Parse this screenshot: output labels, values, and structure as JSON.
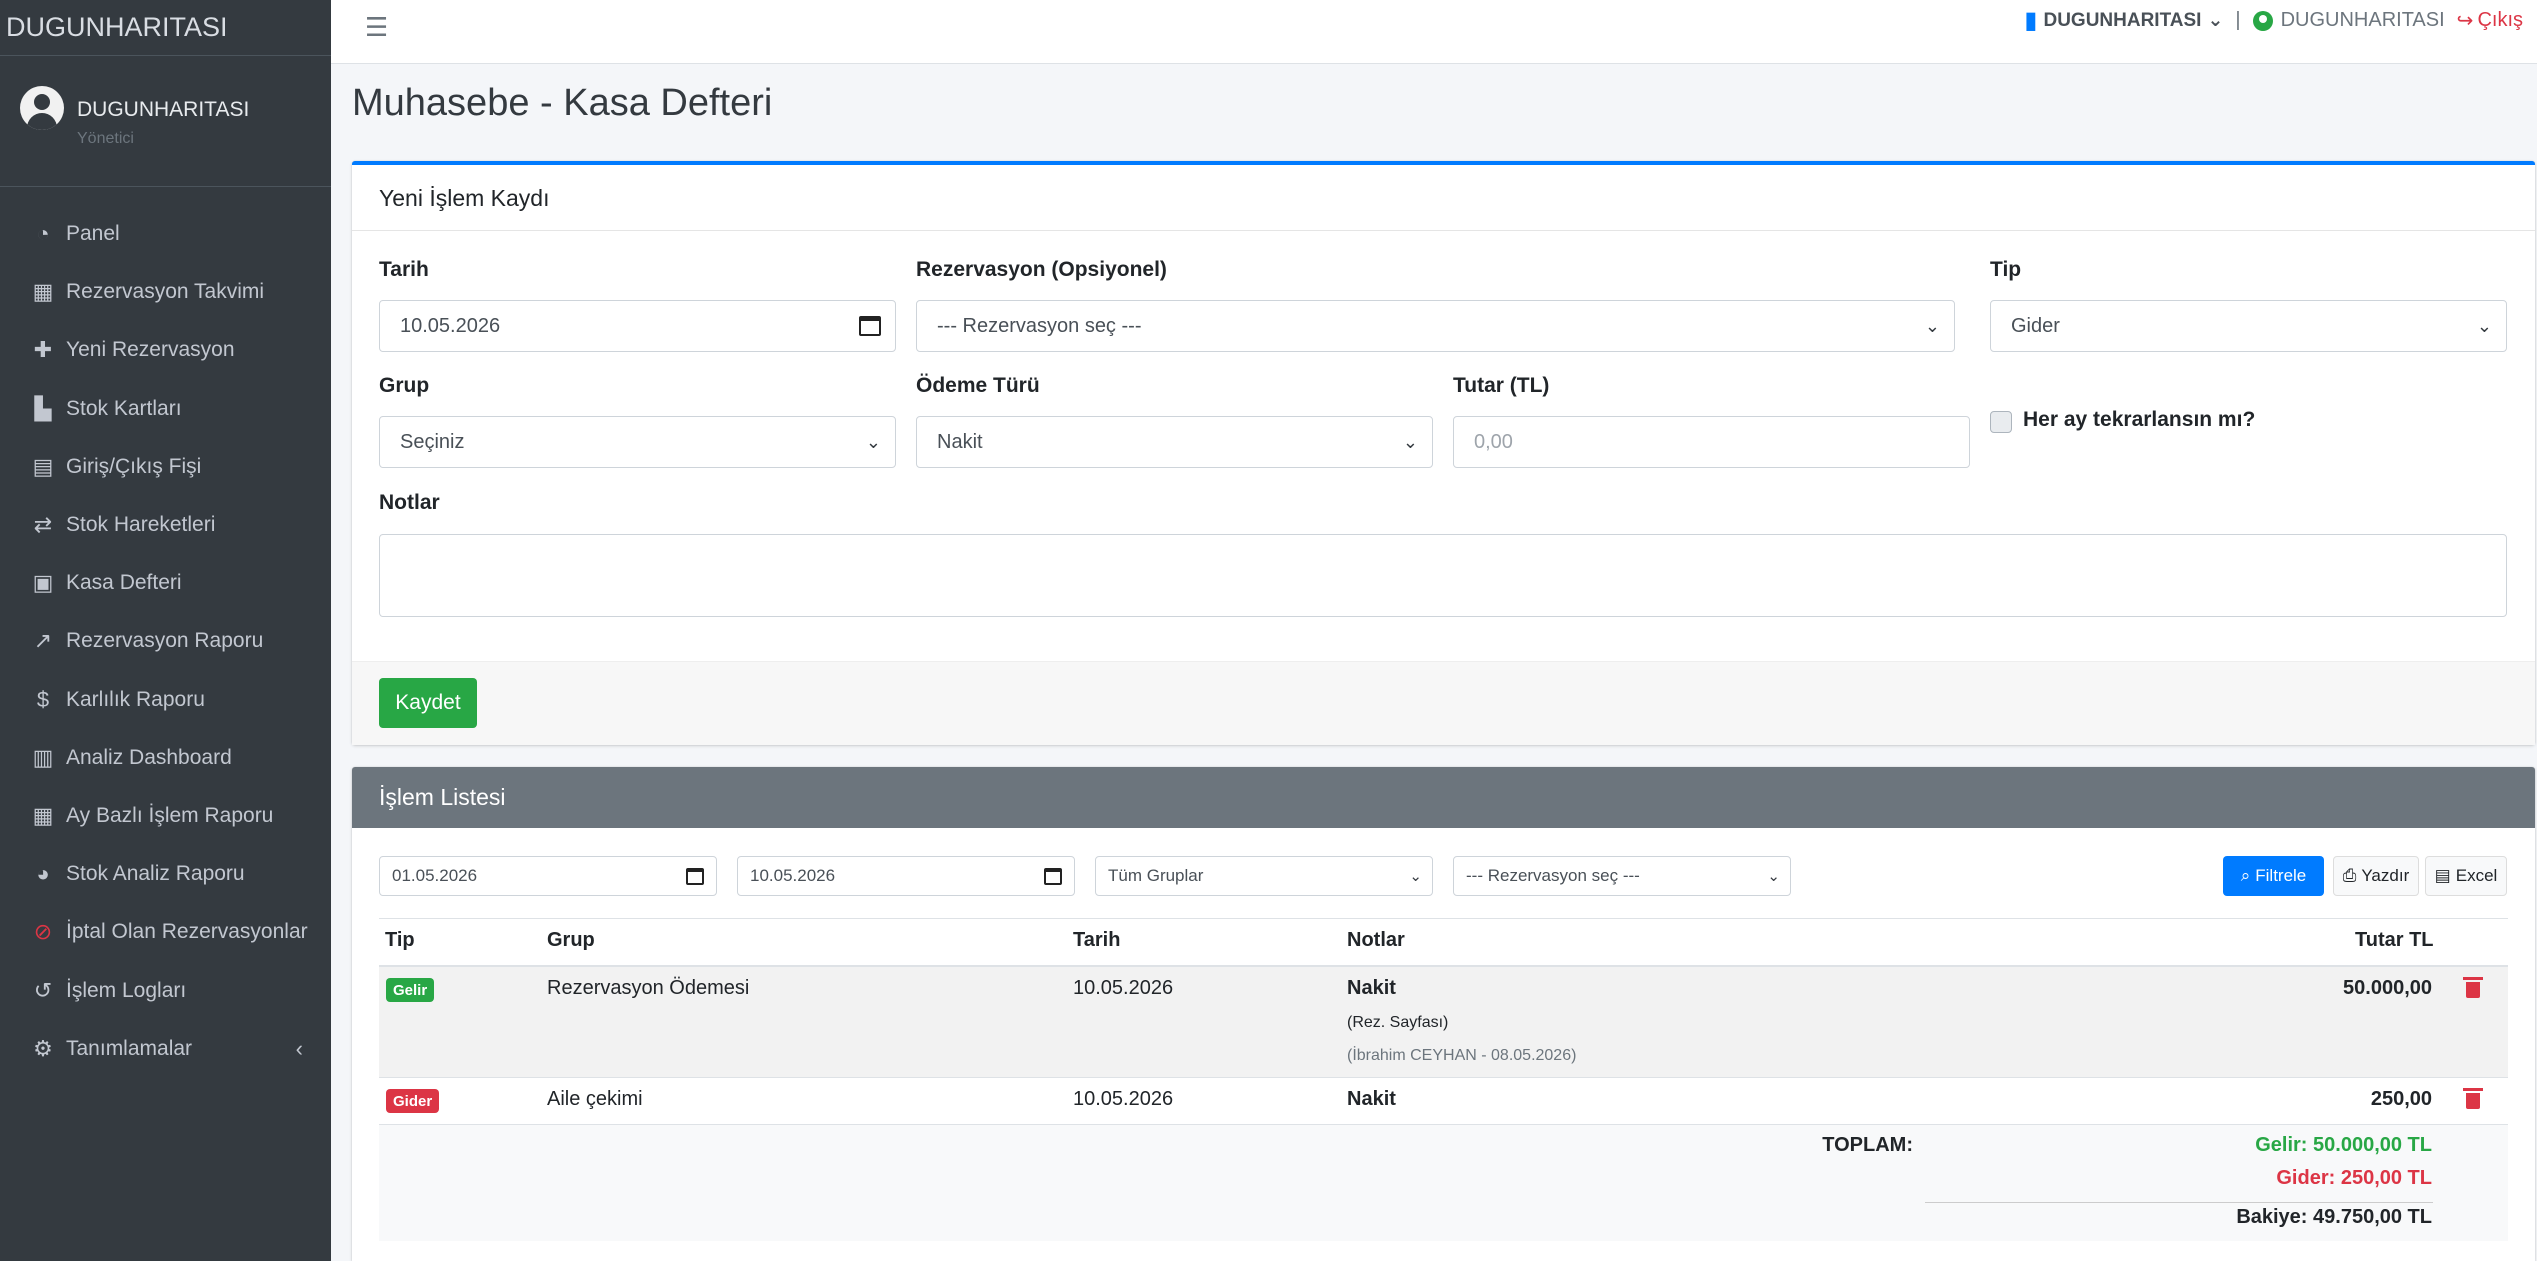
{
  "brand": "DUGUNHARITASI",
  "user": {
    "name": "DUGUNHARITASI",
    "role": "Yönetici"
  },
  "nav": [
    {
      "label": "Panel",
      "icon": "tachometer-icon"
    },
    {
      "label": "Rezervasyon Takvimi",
      "icon": "calendar-icon"
    },
    {
      "label": "Yeni Rezervasyon",
      "icon": "plus-icon"
    },
    {
      "label": "Stok Kartları",
      "icon": "boxes-icon"
    },
    {
      "label": "Giriş/Çıkış Fişi",
      "icon": "file-invoice-icon"
    },
    {
      "label": "Stok Hareketleri",
      "icon": "exchange-icon"
    },
    {
      "label": "Kasa Defteri",
      "icon": "cash-register-icon"
    },
    {
      "label": "Rezervasyon Raporu",
      "icon": "line-chart-icon"
    },
    {
      "label": "Karlılık Raporu",
      "icon": "dollar-icon"
    },
    {
      "label": "Analiz Dashboard",
      "icon": "bar-chart-icon"
    },
    {
      "label": "Ay Bazlı İşlem Raporu",
      "icon": "grid-icon"
    },
    {
      "label": "Stok Analiz Raporu",
      "icon": "pie-chart-icon"
    },
    {
      "label": "İptal Olan Rezervasyonlar",
      "icon": "ban-icon"
    },
    {
      "label": "İşlem Logları",
      "icon": "history-icon"
    },
    {
      "label": "Tanımlamalar",
      "icon": "cogs-icon"
    }
  ],
  "topbar": {
    "company": "DUGUNHARITASI",
    "user": "DUGUNHARITASI",
    "logout": "Çıkış"
  },
  "page_title": "Muhasebe - Kasa Defteri",
  "form": {
    "header": "Yeni İşlem Kaydı",
    "date_label": "Tarih",
    "date_value": "10.05.2026",
    "reservation_label": "Rezervasyon (Opsiyonel)",
    "reservation_value": "--- Rezervasyon seç ---",
    "type_label": "Tip",
    "type_value": "Gider",
    "group_label": "Grup",
    "group_value": "Seçiniz",
    "payment_label": "Ödeme Türü",
    "payment_value": "Nakit",
    "amount_label": "Tutar (TL)",
    "amount_placeholder": "0,00",
    "recurring_label": "Her ay tekrarlansın mı?",
    "notes_label": "Notlar",
    "save_label": "Kaydet"
  },
  "list": {
    "header": "İşlem Listesi",
    "filter_start": "01.05.2026",
    "filter_end": "10.05.2026",
    "filter_group": "Tüm Gruplar",
    "filter_reservation": "--- Rezervasyon seç ---",
    "filter_btn": "Filtrele",
    "print_btn": "Yazdır",
    "excel_btn": "Excel",
    "columns": {
      "type": "Tip",
      "group": "Grup",
      "date": "Tarih",
      "notes": "Notlar",
      "amount": "Tutar TL"
    },
    "rows": [
      {
        "type": "Gelir",
        "group": "Rezervasyon Ödemesi",
        "date": "10.05.2026",
        "note_main": "Nakit",
        "note_sub": "(Rez. Sayfası)",
        "note_meta": "(İbrahim CEYHAN - 08.05.2026)",
        "amount": "50.000,00"
      },
      {
        "type": "Gider",
        "group": "Aile çekimi",
        "date": "10.05.2026",
        "note_main": "Nakit",
        "amount": "250,00"
      }
    ],
    "totals": {
      "label": "TOPLAM:",
      "income": "Gelir: 50.000,00 TL",
      "expense": "Gider: 250,00 TL",
      "balance": "Bakiye: 49.750,00 TL"
    }
  },
  "colors": {
    "primary": "#007bff",
    "success": "#28a745",
    "danger": "#dc3545",
    "sidebar": "#343a40",
    "secondary": "#6c757d"
  }
}
